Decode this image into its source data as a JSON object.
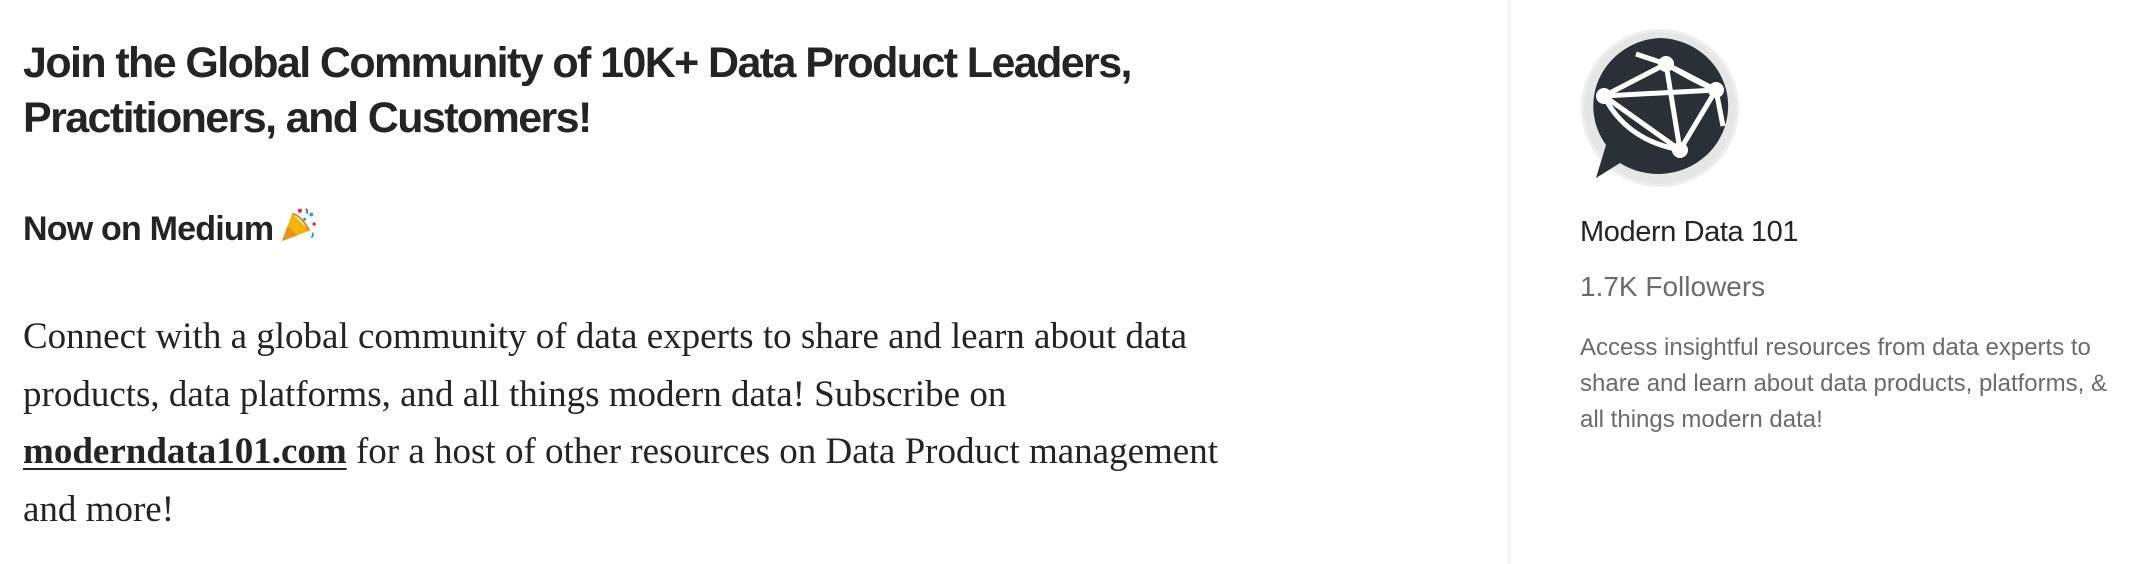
{
  "article": {
    "headline": "Join the Global Community of 10K+ Data Product Leaders, Practitioners, and Customers!",
    "subhead": "Now on Medium",
    "subhead_icon": "party-popper-icon",
    "body_before_link": "Connect with a global community of data experts to share and learn about data products, data platforms, and all things modern data! Subscribe on ",
    "link_text": "moderndata101.com",
    "body_after_link": " for a host of other resources on Data Product management and more!"
  },
  "publication": {
    "avatar_icon": "globe-chat-icon",
    "name": "Modern Data 101",
    "followers": "1.7K Followers",
    "description": "Access insightful resources from data experts to share and learn about data products, platforms, & all things modern data!"
  },
  "colors": {
    "text": "#242424",
    "muted": "#6b6b6b",
    "divider": "#f2f2f2",
    "avatar_dark": "#2b2f36",
    "avatar_ring": "#e6e6e6"
  }
}
